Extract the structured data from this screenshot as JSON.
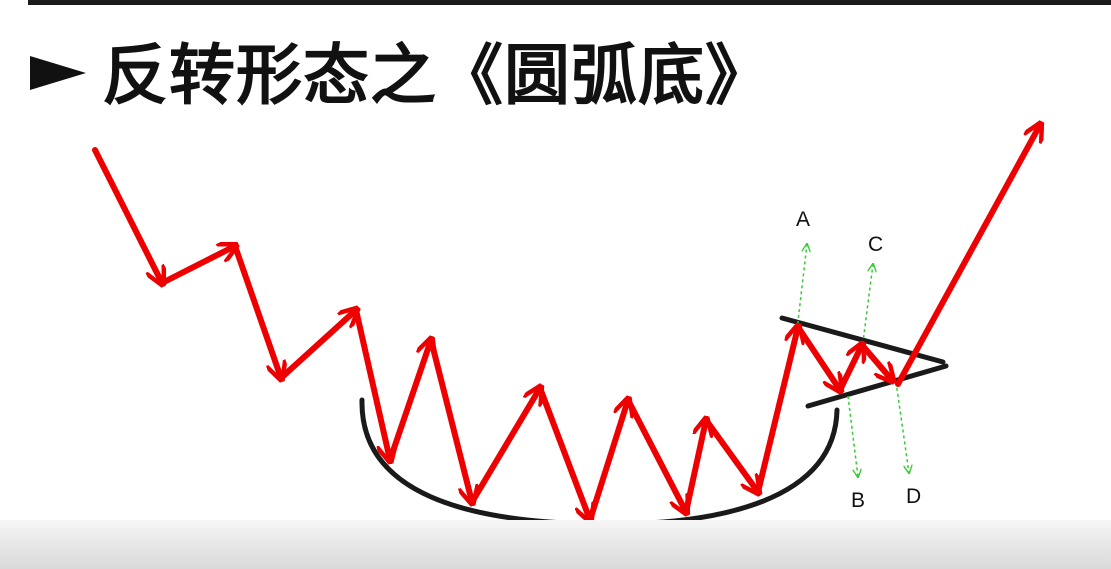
{
  "slide": {
    "title": "反转形态之《圆弧底》",
    "bullet_icon": "right-pointer-icon"
  },
  "diagram": {
    "labels": {
      "a": "A",
      "b": "B",
      "c": "C",
      "d": "D"
    },
    "colors": {
      "price_path": "#ee0000",
      "rounding_bottom_arc": "#1a1a1a",
      "trendlines": "#1a1a1a",
      "projection_lines": "#33cc33"
    }
  }
}
